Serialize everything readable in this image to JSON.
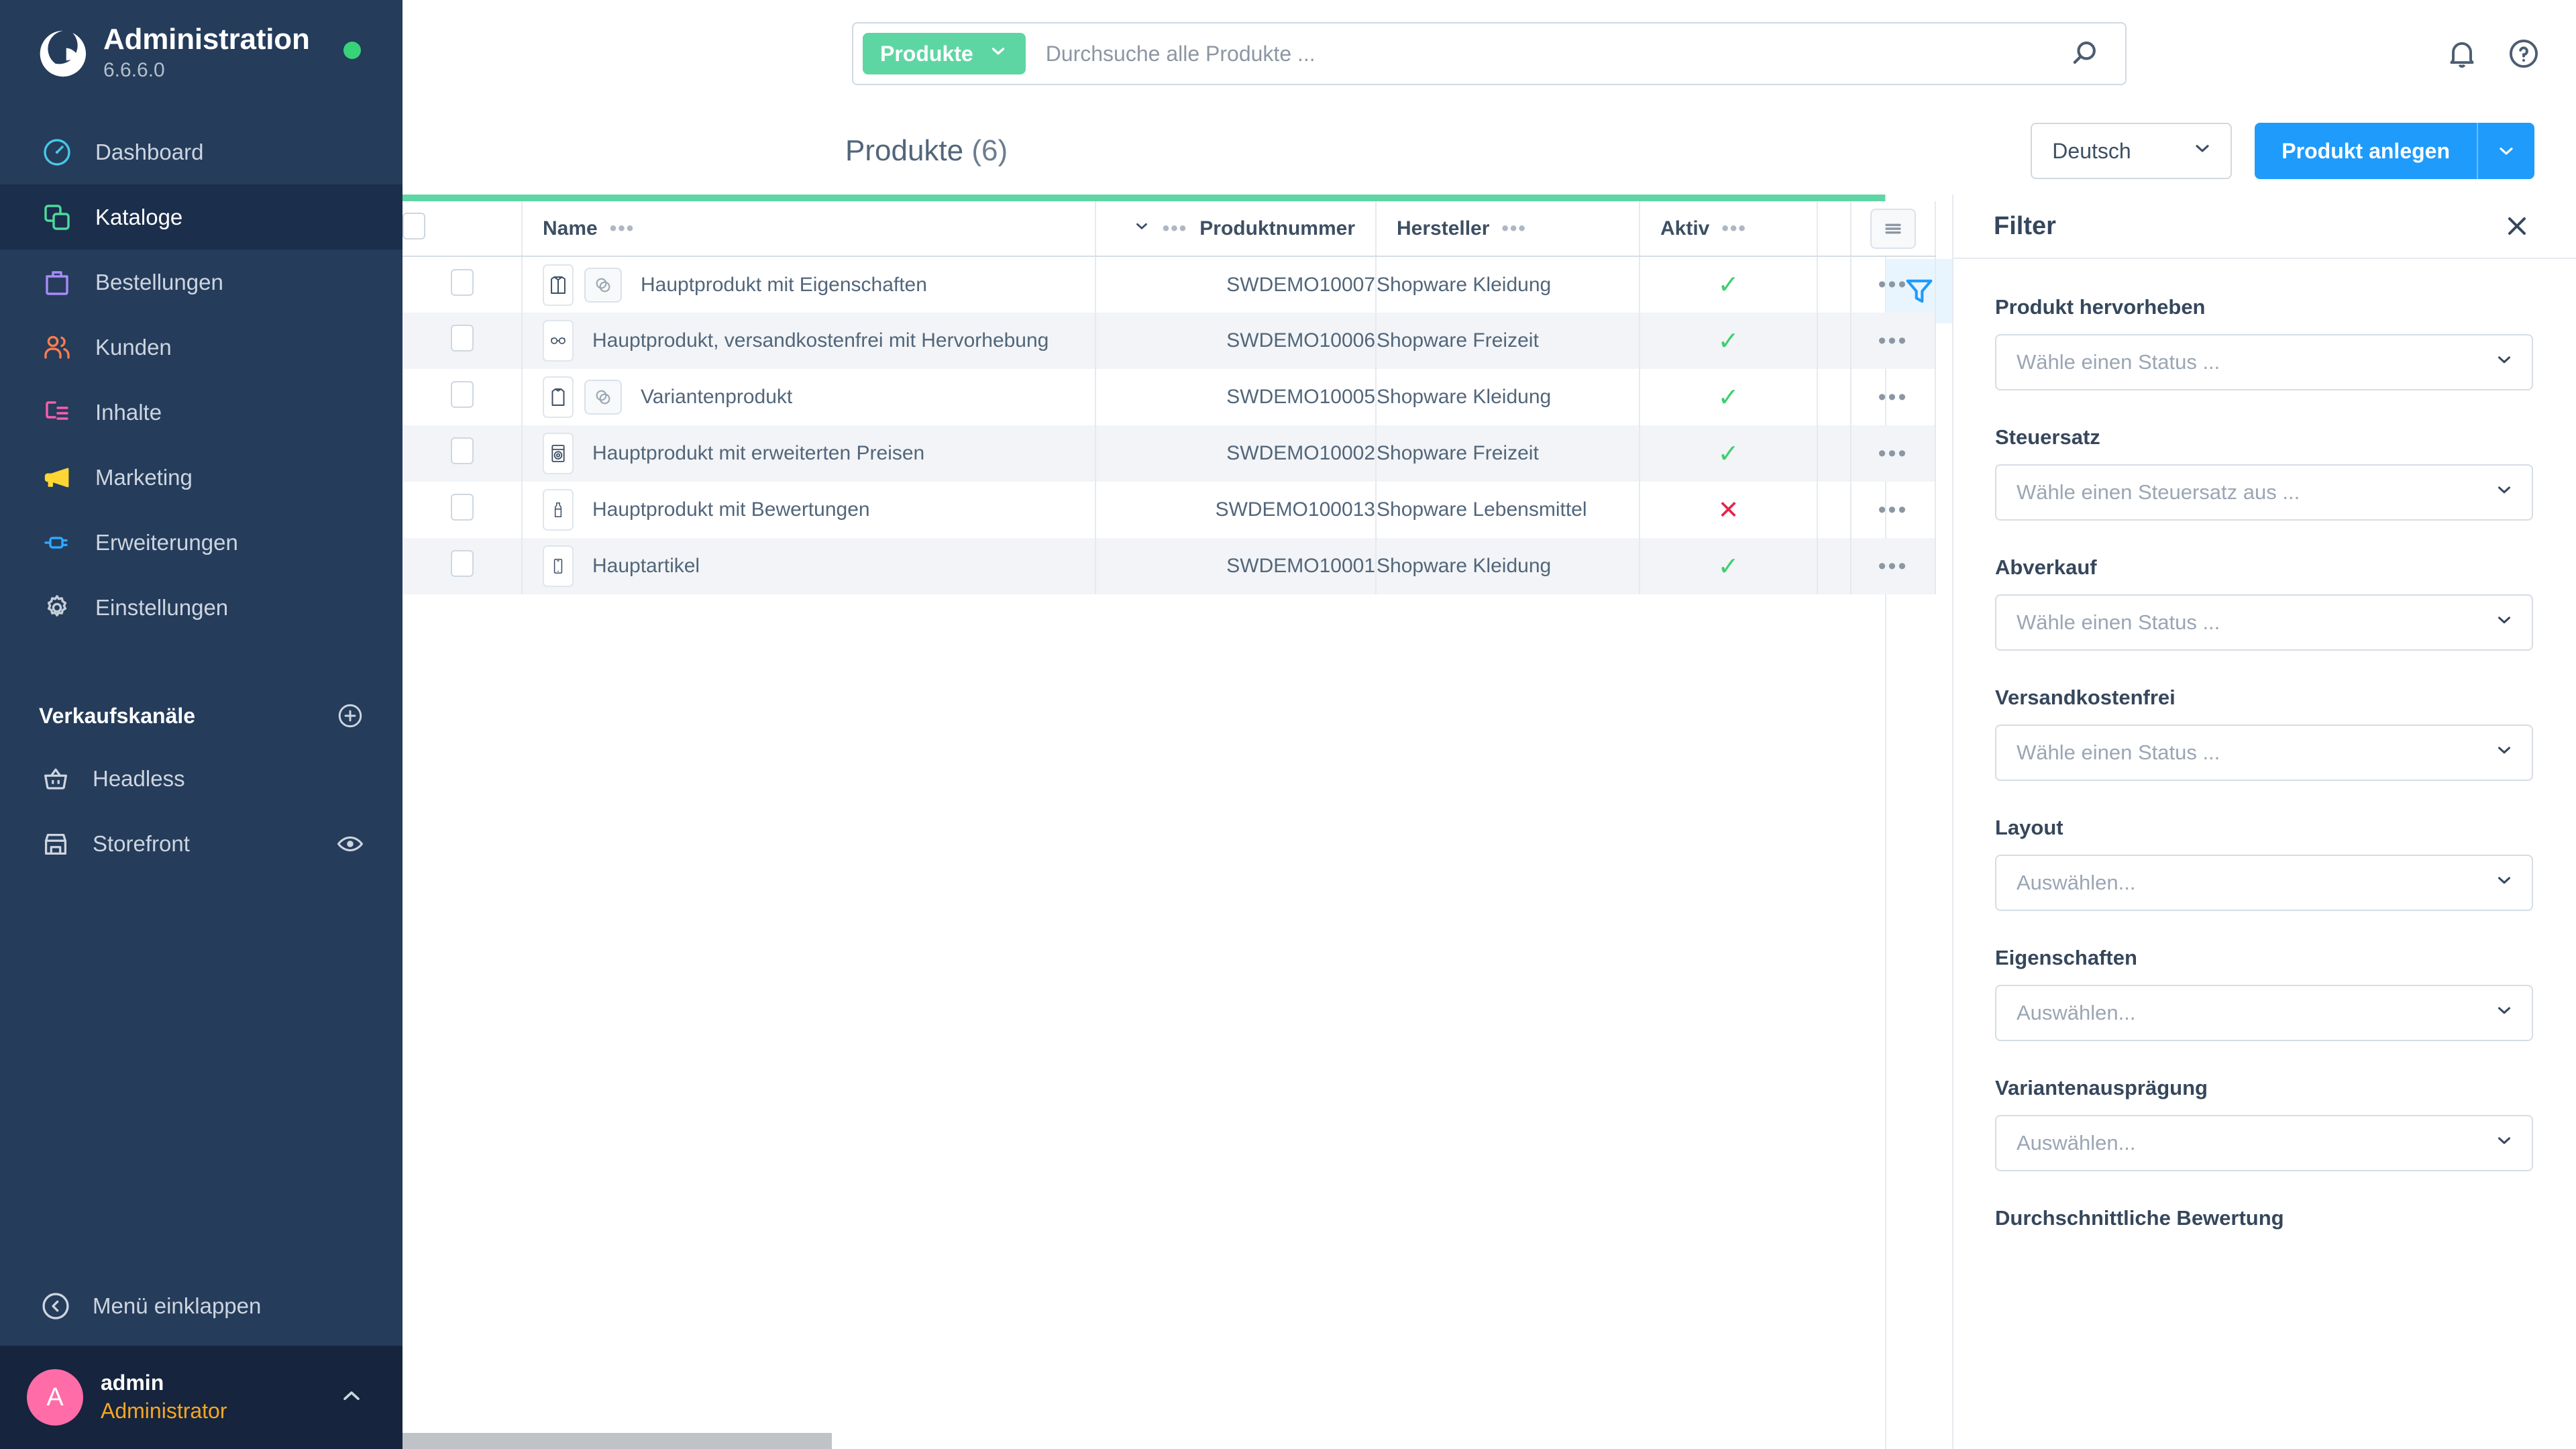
{
  "sidebar": {
    "title": "Administration",
    "version": "6.6.6.0",
    "status_dot_color": "#37d279",
    "items": [
      {
        "label": "Dashboard",
        "icon": "gauge-icon",
        "color": "#46c7e8",
        "active": false
      },
      {
        "label": "Kataloge",
        "icon": "catalog-icon",
        "color": "#4ddb9a",
        "active": true
      },
      {
        "label": "Bestellungen",
        "icon": "bag-icon",
        "color": "#a88bf7",
        "active": false
      },
      {
        "label": "Kunden",
        "icon": "users-icon",
        "color": "#f97d4f",
        "active": false
      },
      {
        "label": "Inhalte",
        "icon": "content-icon",
        "color": "#fc5cae",
        "active": false
      },
      {
        "label": "Marketing",
        "icon": "megaphone-icon",
        "color": "#ffd633",
        "active": false
      },
      {
        "label": "Erweiterungen",
        "icon": "plug-icon",
        "color": "#2ea8ff",
        "active": false
      },
      {
        "label": "Einstellungen",
        "icon": "gear-icon",
        "color": "#c6cdd6",
        "active": false
      }
    ],
    "sales_channels_header": "Verkaufskanäle",
    "channels": [
      {
        "label": "Headless",
        "icon": "basket-icon",
        "has_eye": false
      },
      {
        "label": "Storefront",
        "icon": "storefront-icon",
        "has_eye": true
      }
    ],
    "collapse_label": "Menü einklappen",
    "user": {
      "initial": "A",
      "name": "admin",
      "role": "Administrator",
      "role_color": "#f5a623"
    }
  },
  "topbar": {
    "scope_label": "Produkte",
    "search_placeholder": "Durchsuche alle Produkte ...",
    "search_value": "",
    "icons": [
      "bell-icon",
      "help-icon",
      "search-icon"
    ]
  },
  "pagehead": {
    "title": "Produkte",
    "count": "(6)",
    "language": "Deutsch",
    "create_label": "Produkt anlegen"
  },
  "table": {
    "columns": [
      {
        "label": "",
        "key": "checkbox"
      },
      {
        "label": "Name",
        "key": "name"
      },
      {
        "label": "Produktnummer",
        "key": "number"
      },
      {
        "label": "Hersteller",
        "key": "manufacturer"
      },
      {
        "label": "Aktiv",
        "key": "active"
      },
      {
        "label": "",
        "key": "spacer"
      },
      {
        "label": "",
        "key": "settings"
      }
    ],
    "settings_icon": "columns-settings-icon",
    "rows": [
      {
        "name": "Hauptprodukt mit Eigenschaften",
        "number": "SWDEMO10007",
        "manufacturer": "Shopware Kleidung",
        "active": true,
        "thumb": "jacket-icon",
        "variant_badge": true
      },
      {
        "name": "Hauptprodukt, versandkostenfrei mit Hervorhebung",
        "number": "SWDEMO10006",
        "manufacturer": "Shopware Freizeit",
        "active": true,
        "thumb": "glasses-icon",
        "variant_badge": false
      },
      {
        "name": "Variantenprodukt",
        "number": "SWDEMO10005",
        "manufacturer": "Shopware Kleidung",
        "active": true,
        "thumb": "dress-icon",
        "variant_badge": true
      },
      {
        "name": "Hauptprodukt mit erweiterten Preisen",
        "number": "SWDEMO10002",
        "manufacturer": "Shopware Freizeit",
        "active": true,
        "thumb": "washer-icon",
        "variant_badge": false
      },
      {
        "name": "Hauptprodukt mit Bewertungen",
        "number": "SWDEMO100013",
        "manufacturer": "Shopware Lebensmittel",
        "active": false,
        "thumb": "bottle-icon",
        "variant_badge": false
      },
      {
        "name": "Hauptartikel",
        "number": "SWDEMO10001",
        "manufacturer": "Shopware Kleidung",
        "active": true,
        "thumb": "phone-icon",
        "variant_badge": false
      }
    ],
    "row_action_label": "•••",
    "active_true_glyph": "✓",
    "active_false_glyph": "✕"
  },
  "rail": {
    "reset_icon": "reset-icon",
    "filter_icon": "filter-icon"
  },
  "filter_panel": {
    "title": "Filter",
    "close_icon": "close-icon",
    "groups": [
      {
        "label": "Produkt hervorheben",
        "placeholder": "Wähle einen Status ..."
      },
      {
        "label": "Steuersatz",
        "placeholder": "Wähle einen Steuersatz aus ..."
      },
      {
        "label": "Abverkauf",
        "placeholder": "Wähle einen Status ..."
      },
      {
        "label": "Versandkostenfrei",
        "placeholder": "Wähle einen Status ..."
      },
      {
        "label": "Layout",
        "placeholder": "Auswählen..."
      },
      {
        "label": "Eigenschaften",
        "placeholder": "Auswählen..."
      },
      {
        "label": "Variantenausprägung",
        "placeholder": "Auswählen..."
      },
      {
        "label": "Durchschnittliche Bewertung",
        "placeholder": ""
      }
    ]
  },
  "colors": {
    "sidebar_bg": "#253c5b",
    "sidebar_active": "#1b2e4b",
    "accent_green": "#5ed6a4",
    "primary_blue": "#1f9bfb",
    "active_check": "#3ecf6e",
    "inactive_cross": "#e2264d"
  }
}
